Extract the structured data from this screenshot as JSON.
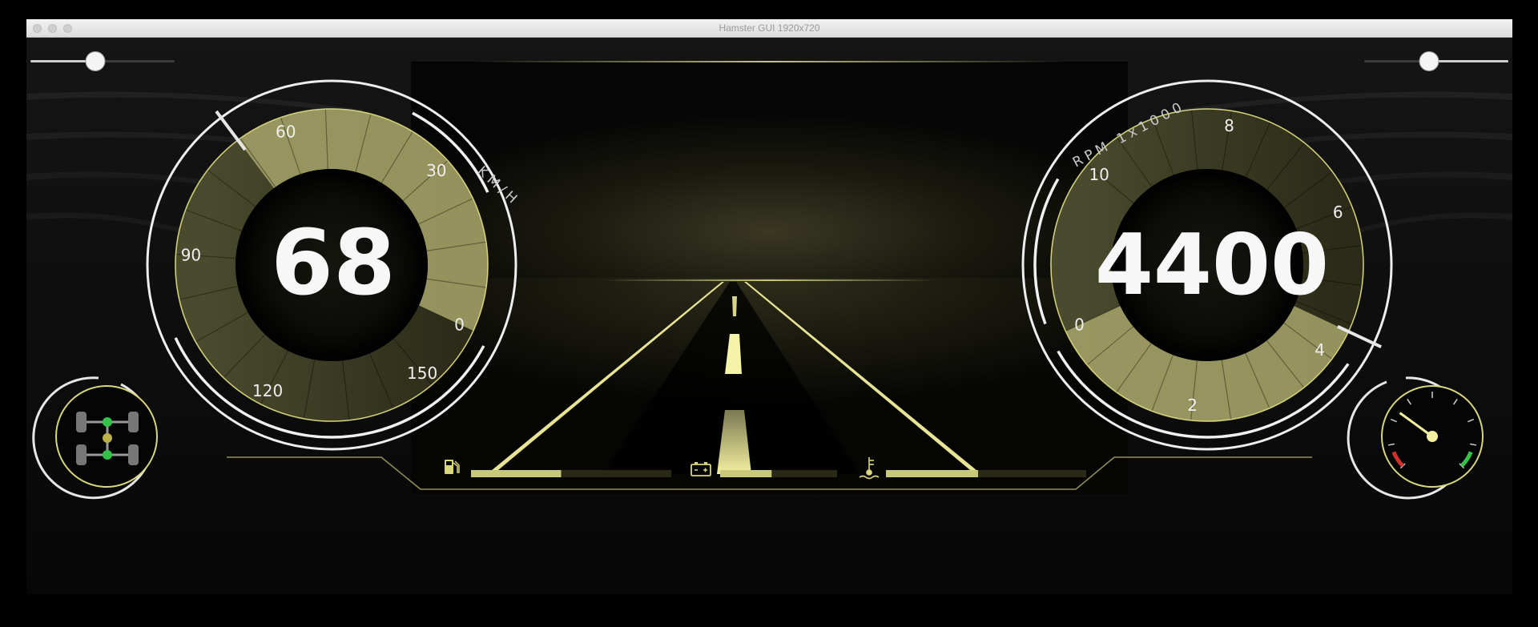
{
  "window": {
    "title": "Hamster GUI 1920x720"
  },
  "controls": {
    "left_slider": {
      "value": 0.45
    },
    "right_slider": {
      "value": 0.45
    }
  },
  "speedometer": {
    "value_text": "68",
    "unit_label": "KM/H",
    "min": 0,
    "max": 150,
    "value": 68,
    "ticks": [
      "0",
      "30",
      "60",
      "90",
      "120",
      "150"
    ]
  },
  "tachometer": {
    "value_text": "4400",
    "unit_label": "RPM 1x1000",
    "min": 0,
    "max": 10,
    "value": 4.4,
    "ticks": [
      "0",
      "2",
      "4",
      "6",
      "8",
      "10"
    ]
  },
  "status_bars": [
    {
      "icon": "fuel-pump-icon",
      "level": 0.45
    },
    {
      "icon": "battery-icon",
      "level": 0.44
    },
    {
      "icon": "coolant-temperature-icon",
      "level": 0.46
    }
  ],
  "gauge_small": {
    "level": 0.3
  },
  "colors": {
    "accent": "#c8c87a",
    "accent_bright": "#f5f3a8",
    "green": "#35c24a",
    "red": "#d0302a"
  }
}
